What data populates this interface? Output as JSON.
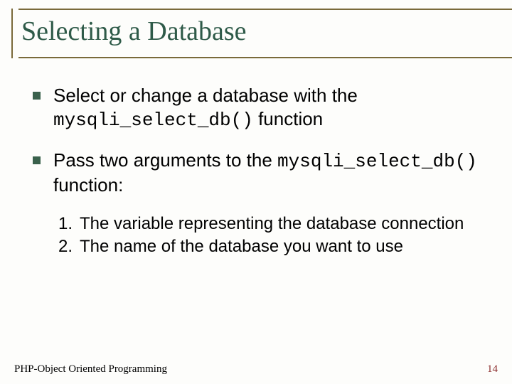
{
  "title": "Selecting a Database",
  "bullets": [
    {
      "pre": "Select or change a database with the ",
      "code": "mysqli_select_db()",
      "post": " function"
    },
    {
      "pre": "Pass two arguments to the ",
      "code": "mysqli_select_db()",
      "post": " function:"
    }
  ],
  "numbered": [
    {
      "n": "1.",
      "text": "The variable representing the database connection"
    },
    {
      "n": "2.",
      "text": "The name of the database you want to use"
    }
  ],
  "footer": {
    "left": "PHP-Object Oriented Programming",
    "page": "14"
  }
}
